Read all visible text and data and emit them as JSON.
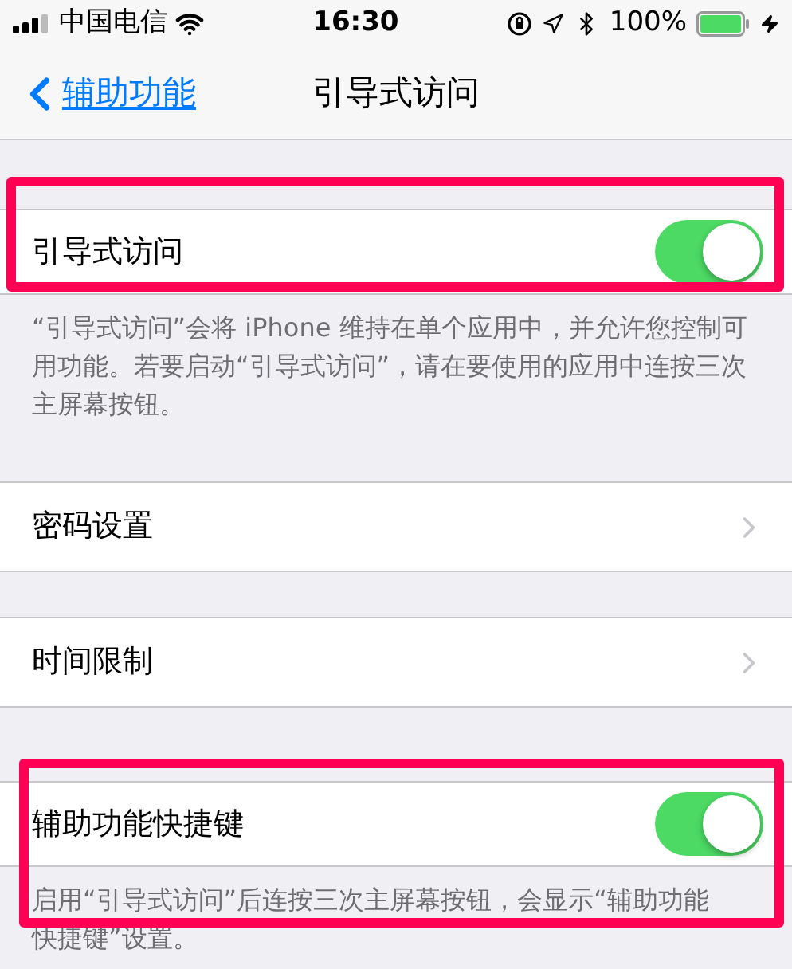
{
  "status_bar": {
    "carrier": "中国电信",
    "time": "16:30",
    "battery": "100%"
  },
  "nav": {
    "back": "辅助功能",
    "title": "引导式访问"
  },
  "groups": [
    {
      "highlighted": true,
      "rows": [
        {
          "kind": "toggle",
          "label": "引导式访问",
          "on": true
        }
      ],
      "footer": [
        "“引导式访问”会将 iPhone 维持在单个应用中，并允许您控制可用功能。若要启动“引导式访问”，请在要使用的应用中连按三次主屏幕按钮。"
      ]
    },
    {
      "highlighted": false,
      "rows": [
        {
          "kind": "link",
          "label": "密码设置"
        }
      ]
    },
    {
      "highlighted": false,
      "rows": [
        {
          "kind": "link",
          "label": "时间限制"
        }
      ]
    },
    {
      "highlighted": true,
      "rows": [
        {
          "kind": "toggle",
          "label": "辅助功能快捷键",
          "on": true
        }
      ],
      "footer": [
        "启用“引导式访问”后连按三次主屏幕按钮，会显示“辅助功能",
        "快捷键”设置。"
      ]
    }
  ]
}
